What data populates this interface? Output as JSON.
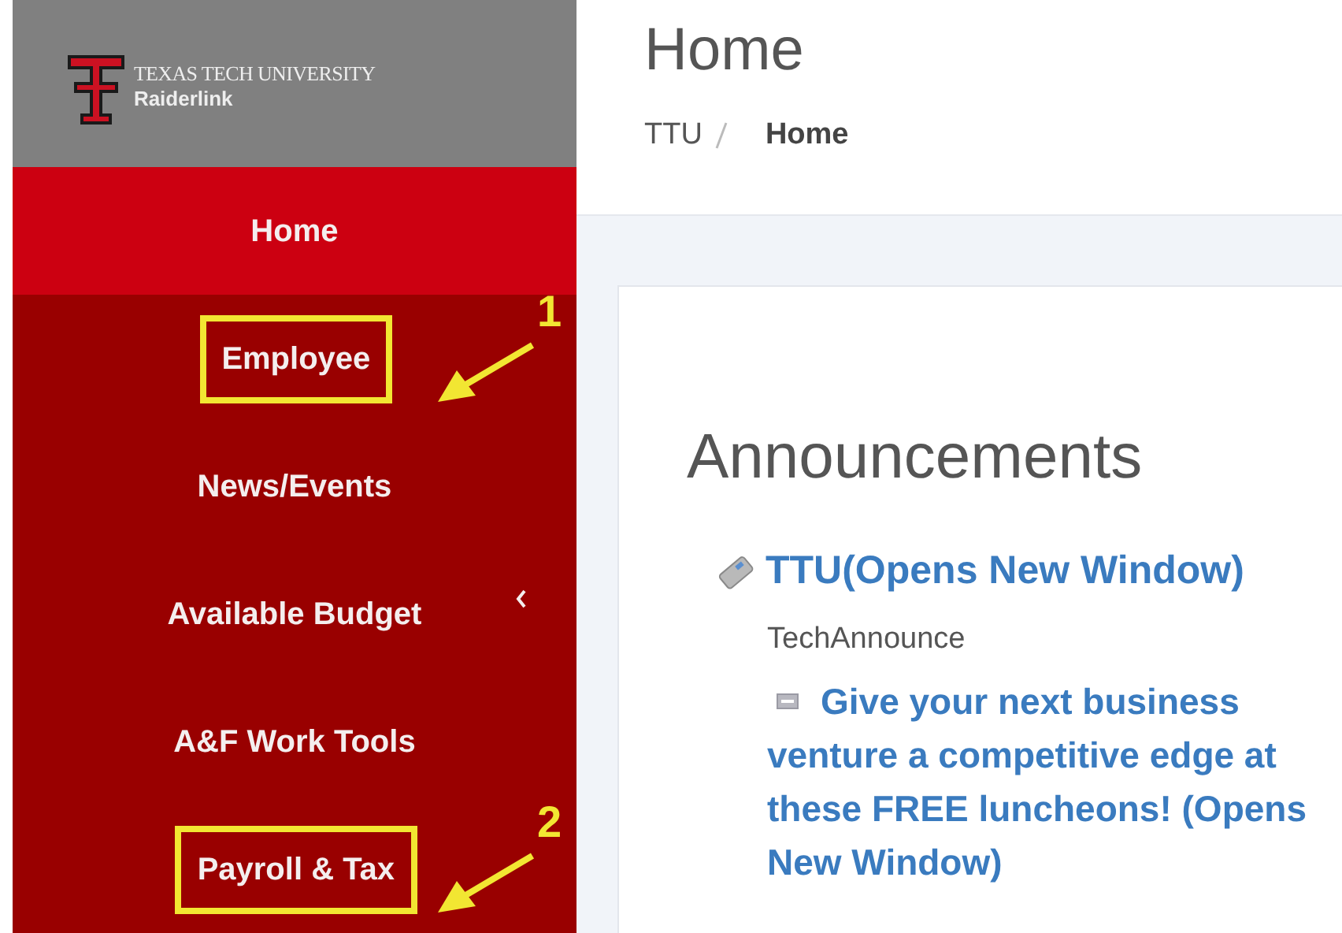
{
  "logo": {
    "university": "TEXAS TECH UNIVERSITY",
    "product": "Raiderlink"
  },
  "sidebar": {
    "items": [
      {
        "label": "Home",
        "selected": true
      },
      {
        "label": "Employee",
        "selected": false,
        "callout": "1"
      },
      {
        "label": "News/Events",
        "selected": false
      },
      {
        "label": "Available Budget",
        "selected": false,
        "submenu": true
      },
      {
        "label": "A&F Work Tools",
        "selected": false
      },
      {
        "label": "Payroll & Tax",
        "selected": false,
        "callout": "2"
      }
    ]
  },
  "header": {
    "title": "Home",
    "breadcrumb": [
      {
        "label": "TTU",
        "current": false
      },
      {
        "label": "Home",
        "current": true
      }
    ]
  },
  "announcements": {
    "title": "Announcements",
    "feed": "TTU(Opens New Window)",
    "source": "TechAnnounce",
    "items": [
      "Give your next business venture a competitive edge at these FREE luncheons! (Opens New Window)"
    ]
  }
}
